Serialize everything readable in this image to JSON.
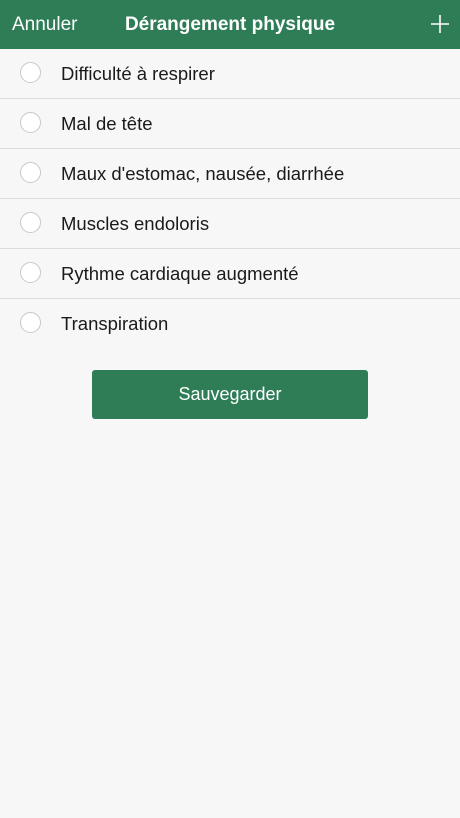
{
  "header": {
    "cancel_label": "Annuler",
    "title": "Dérangement physique",
    "add_icon": "plus-icon"
  },
  "options": [
    {
      "label": "Difficulté à respirer",
      "selected": false
    },
    {
      "label": "Mal de tête",
      "selected": false
    },
    {
      "label": "Maux d'estomac, nausée, diarrhée",
      "selected": false
    },
    {
      "label": "Muscles endoloris",
      "selected": false
    },
    {
      "label": "Rythme cardiaque augmenté",
      "selected": false
    },
    {
      "label": "Transpiration",
      "selected": false
    }
  ],
  "save_label": "Sauvegarder",
  "colors": {
    "accent": "#2e7d57",
    "background": "#f7f7f7",
    "divider": "#dcdcdc"
  }
}
